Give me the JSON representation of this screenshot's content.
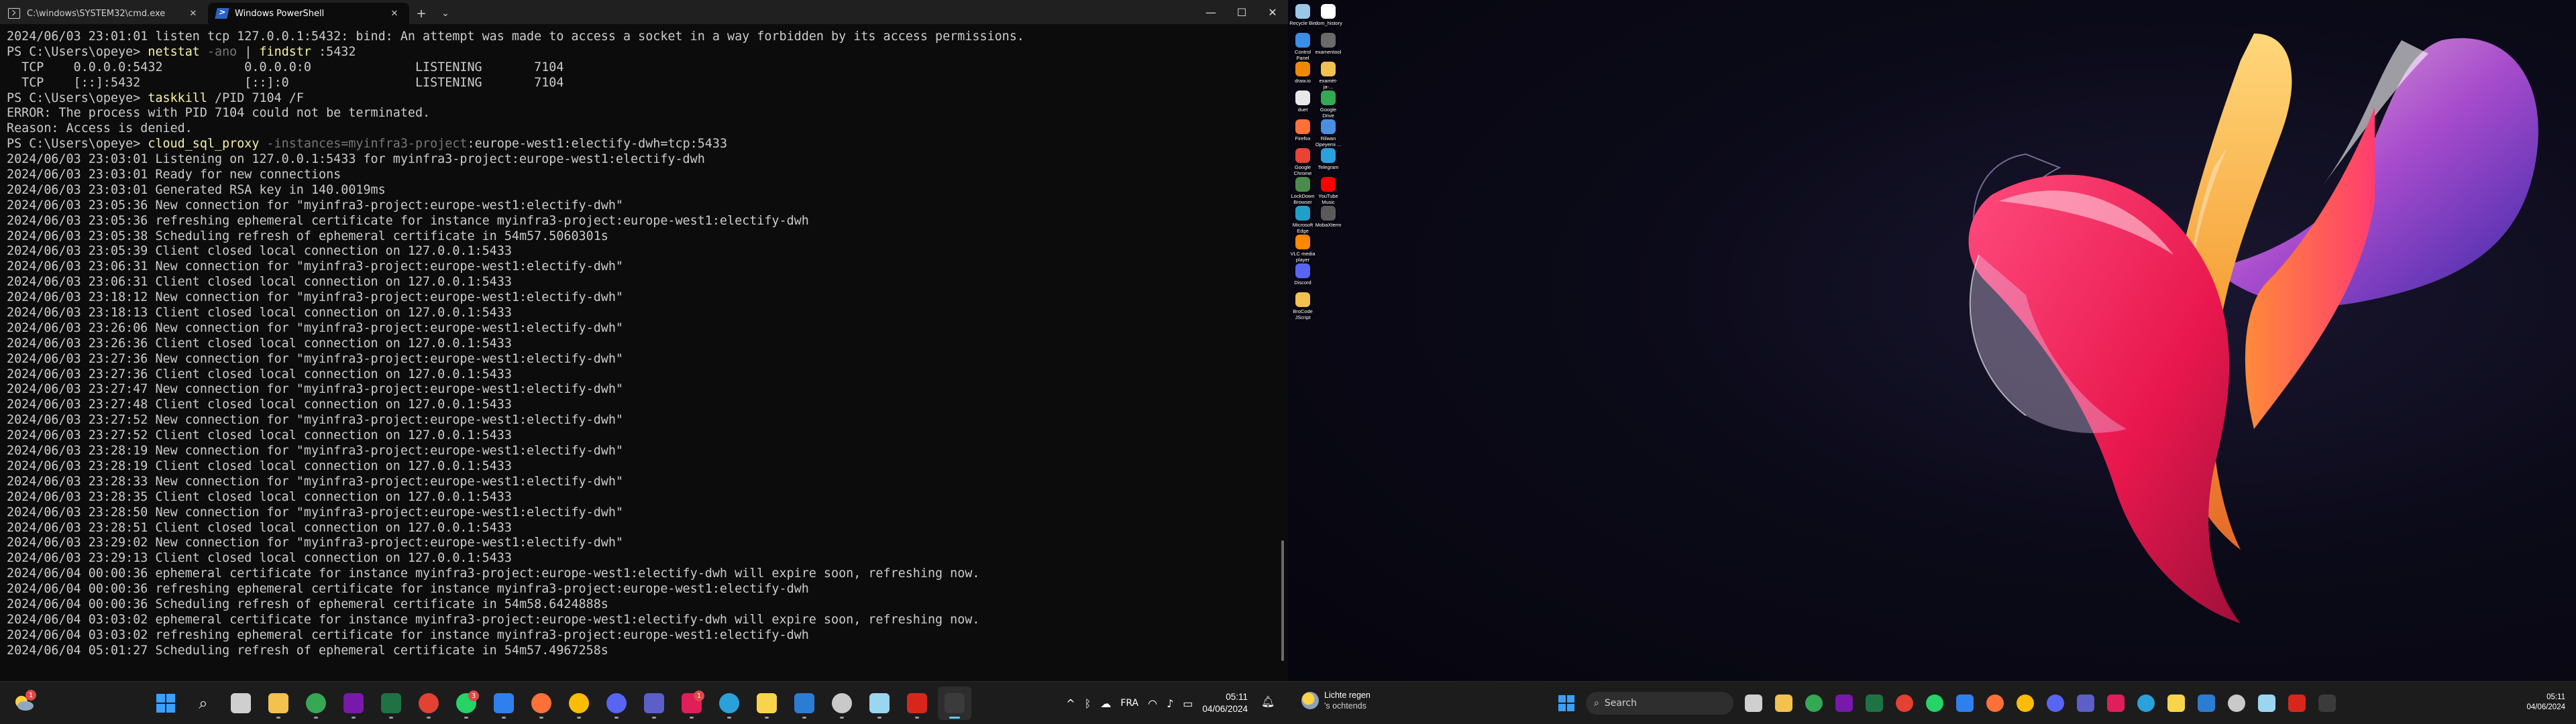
{
  "left_window": {
    "tabs": [
      {
        "title": "C:\\windows\\SYSTEM32\\cmd.exe",
        "active": false
      },
      {
        "title": "Windows PowerShell",
        "active": true
      }
    ],
    "new_tab": "+",
    "tab_dropdown": "⌄",
    "controls": {
      "minimize": "—",
      "maximize": "☐",
      "close": "✕"
    }
  },
  "terminal_lines": [
    [
      {
        "c": "plain",
        "t": "2024/06/03 23:01:01 listen tcp 127.0.0.1:5432: bind: An attempt was made to access a socket in a way forbidden by its access permissions."
      }
    ],
    [
      {
        "c": "prompt",
        "t": "PS C:\\Users\\opeye> "
      },
      {
        "c": "cmd",
        "t": "netstat"
      },
      {
        "c": "arg",
        "t": " -ano"
      },
      {
        "c": "plain",
        "t": " | "
      },
      {
        "c": "cmd",
        "t": "findstr"
      },
      {
        "c": "plain",
        "t": " :5432"
      }
    ],
    [
      {
        "c": "plain",
        "t": "  TCP    0.0.0.0:5432           0.0.0.0:0              LISTENING       7104"
      }
    ],
    [
      {
        "c": "plain",
        "t": "  TCP    [::]:5432              [::]:0                 LISTENING       7104"
      }
    ],
    [
      {
        "c": "prompt",
        "t": "PS C:\\Users\\opeye> "
      },
      {
        "c": "cmd",
        "t": "taskkill"
      },
      {
        "c": "plain",
        "t": " /PID 7104 /F"
      }
    ],
    [
      {
        "c": "plain",
        "t": "ERROR: The process with PID 7104 could not be terminated."
      }
    ],
    [
      {
        "c": "plain",
        "t": "Reason: Access is denied."
      }
    ],
    [
      {
        "c": "prompt",
        "t": "PS C:\\Users\\opeye> "
      },
      {
        "c": "cmd",
        "t": "cloud_sql_proxy"
      },
      {
        "c": "arg",
        "t": " -instances=myinfra3-project"
      },
      {
        "c": "plain",
        "t": ":europe-west1:electify-dwh=tcp:5433"
      }
    ],
    [
      {
        "c": "plain",
        "t": "2024/06/03 23:03:01 Listening on 127.0.0.1:5433 for myinfra3-project:europe-west1:electify-dwh"
      }
    ],
    [
      {
        "c": "plain",
        "t": "2024/06/03 23:03:01 Ready for new connections"
      }
    ],
    [
      {
        "c": "plain",
        "t": "2024/06/03 23:03:01 Generated RSA key in 140.0019ms"
      }
    ],
    [
      {
        "c": "plain",
        "t": "2024/06/03 23:05:36 New connection for \"myinfra3-project:europe-west1:electify-dwh\""
      }
    ],
    [
      {
        "c": "plain",
        "t": "2024/06/03 23:05:36 refreshing ephemeral certificate for instance myinfra3-project:europe-west1:electify-dwh"
      }
    ],
    [
      {
        "c": "plain",
        "t": "2024/06/03 23:05:38 Scheduling refresh of ephemeral certificate in 54m57.5060301s"
      }
    ],
    [
      {
        "c": "plain",
        "t": "2024/06/03 23:05:39 Client closed local connection on 127.0.0.1:5433"
      }
    ],
    [
      {
        "c": "plain",
        "t": "2024/06/03 23:06:31 New connection for \"myinfra3-project:europe-west1:electify-dwh\""
      }
    ],
    [
      {
        "c": "plain",
        "t": "2024/06/03 23:06:31 Client closed local connection on 127.0.0.1:5433"
      }
    ],
    [
      {
        "c": "plain",
        "t": "2024/06/03 23:18:12 New connection for \"myinfra3-project:europe-west1:electify-dwh\""
      }
    ],
    [
      {
        "c": "plain",
        "t": "2024/06/03 23:18:13 Client closed local connection on 127.0.0.1:5433"
      }
    ],
    [
      {
        "c": "plain",
        "t": "2024/06/03 23:26:06 New connection for \"myinfra3-project:europe-west1:electify-dwh\""
      }
    ],
    [
      {
        "c": "plain",
        "t": "2024/06/03 23:26:36 Client closed local connection on 127.0.0.1:5433"
      }
    ],
    [
      {
        "c": "plain",
        "t": "2024/06/03 23:27:36 New connection for \"myinfra3-project:europe-west1:electify-dwh\""
      }
    ],
    [
      {
        "c": "plain",
        "t": "2024/06/03 23:27:36 Client closed local connection on 127.0.0.1:5433"
      }
    ],
    [
      {
        "c": "plain",
        "t": "2024/06/03 23:27:47 New connection for \"myinfra3-project:europe-west1:electify-dwh\""
      }
    ],
    [
      {
        "c": "plain",
        "t": "2024/06/03 23:27:48 Client closed local connection on 127.0.0.1:5433"
      }
    ],
    [
      {
        "c": "plain",
        "t": "2024/06/03 23:27:52 New connection for \"myinfra3-project:europe-west1:electify-dwh\""
      }
    ],
    [
      {
        "c": "plain",
        "t": "2024/06/03 23:27:52 Client closed local connection on 127.0.0.1:5433"
      }
    ],
    [
      {
        "c": "plain",
        "t": "2024/06/03 23:28:19 New connection for \"myinfra3-project:europe-west1:electify-dwh\""
      }
    ],
    [
      {
        "c": "plain",
        "t": "2024/06/03 23:28:19 Client closed local connection on 127.0.0.1:5433"
      }
    ],
    [
      {
        "c": "plain",
        "t": "2024/06/03 23:28:33 New connection for \"myinfra3-project:europe-west1:electify-dwh\""
      }
    ],
    [
      {
        "c": "plain",
        "t": "2024/06/03 23:28:35 Client closed local connection on 127.0.0.1:5433"
      }
    ],
    [
      {
        "c": "plain",
        "t": "2024/06/03 23:28:50 New connection for \"myinfra3-project:europe-west1:electify-dwh\""
      }
    ],
    [
      {
        "c": "plain",
        "t": "2024/06/03 23:28:51 Client closed local connection on 127.0.0.1:5433"
      }
    ],
    [
      {
        "c": "plain",
        "t": "2024/06/03 23:29:02 New connection for \"myinfra3-project:europe-west1:electify-dwh\""
      }
    ],
    [
      {
        "c": "plain",
        "t": "2024/06/03 23:29:13 Client closed local connection on 127.0.0.1:5433"
      }
    ],
    [
      {
        "c": "plain",
        "t": "2024/06/04 00:00:36 ephemeral certificate for instance myinfra3-project:europe-west1:electify-dwh will expire soon, refreshing now."
      }
    ],
    [
      {
        "c": "plain",
        "t": "2024/06/04 00:00:36 refreshing ephemeral certificate for instance myinfra3-project:europe-west1:electify-dwh"
      }
    ],
    [
      {
        "c": "plain",
        "t": "2024/06/04 00:00:36 Scheduling refresh of ephemeral certificate in 54m58.6424888s"
      }
    ],
    [
      {
        "c": "plain",
        "t": "2024/06/04 03:03:02 ephemeral certificate for instance myinfra3-project:europe-west1:electify-dwh will expire soon, refreshing now."
      }
    ],
    [
      {
        "c": "plain",
        "t": "2024/06/04 03:03:02 refreshing ephemeral certificate for instance myinfra3-project:europe-west1:electify-dwh"
      }
    ],
    [
      {
        "c": "plain",
        "t": "2024/06/04 05:01:27 Scheduling refresh of ephemeral certificate in 54m57.4967258s"
      }
    ]
  ],
  "taskbar_left": {
    "weather_badge": "1",
    "icons": [
      {
        "name": "start",
        "color": "#3aa0ff"
      },
      {
        "name": "search",
        "color": "#dddddd"
      },
      {
        "name": "task-view",
        "color": "#cfcfcf"
      },
      {
        "name": "file-explorer",
        "color": "#f2c14e"
      },
      {
        "name": "chrome",
        "color": "#34a853"
      },
      {
        "name": "onenote",
        "color": "#7719aa"
      },
      {
        "name": "excel",
        "color": "#1f7244"
      },
      {
        "name": "chrome-profile",
        "color": "#e34133"
      },
      {
        "name": "whatsapp",
        "color": "#25d366",
        "badge": "3"
      },
      {
        "name": "vscode",
        "color": "#2f80ed"
      },
      {
        "name": "firefox",
        "color": "#ff7139"
      },
      {
        "name": "chrome-2",
        "color": "#fbbc05"
      },
      {
        "name": "discord",
        "color": "#5865f2"
      },
      {
        "name": "teams",
        "color": "#5b5fc7"
      },
      {
        "name": "slack",
        "color": "#e01e5a",
        "badge": "1"
      },
      {
        "name": "telegram",
        "color": "#2aa1da"
      },
      {
        "name": "sticky-notes",
        "color": "#f7d44c"
      },
      {
        "name": "word-doc",
        "color": "#2b7cd3"
      },
      {
        "name": "clock-app",
        "color": "#c9c9c9"
      },
      {
        "name": "snipping",
        "color": "#9ad6f0"
      },
      {
        "name": "acrobat",
        "color": "#d9261c"
      },
      {
        "name": "terminal",
        "color": "#3b3b3b",
        "active": true
      }
    ],
    "tray": {
      "chevron": "^",
      "lang": "FRA"
    },
    "time": "05:11",
    "date": "04/06/2024"
  },
  "desktop_icons": [
    {
      "label": "Recycle Bin",
      "color": "#9cc7e8"
    },
    {
      "label": "dom_history",
      "color": "#ffffff"
    },
    {
      "label": "Control Panel",
      "color": "#3a8ee6"
    },
    {
      "label": "examentool",
      "color": "#6a6a6a"
    },
    {
      "label": "draw.io",
      "color": "#f08705"
    },
    {
      "label": "examét-ja-...",
      "color": "#f2c14e"
    },
    {
      "label": "duet",
      "color": "#e8e8e8"
    },
    {
      "label": "Google Drive",
      "color": "#34a853"
    },
    {
      "label": "Firefox",
      "color": "#ff7139"
    },
    {
      "label": "Rilwan Opeyemi ...",
      "color": "#4a90e2"
    },
    {
      "label": "Google Chrome",
      "color": "#ea4335"
    },
    {
      "label": "Telegram",
      "color": "#2aa1da"
    },
    {
      "label": "LockDown Browser",
      "color": "#4c8c4a"
    },
    {
      "label": "YouTube Music",
      "color": "#ff0000"
    },
    {
      "label": "Microsoft Edge",
      "color": "#1fa0c9"
    },
    {
      "label": "MobaXterm",
      "color": "#5a5a5a"
    },
    {
      "label": "VLC media player",
      "color": "#ff8800"
    },
    {
      "label": "Discord",
      "color": "#5865f2"
    },
    {
      "label": "BroCode JScript",
      "color": "#f2c14e"
    }
  ],
  "taskbar_right": {
    "weather_title": "Lichte regen",
    "weather_sub": "'s ochtends",
    "search_placeholder": "Search",
    "icons": [
      {
        "name": "task-view",
        "color": "#cfcfcf"
      },
      {
        "name": "file-explorer",
        "color": "#f2c14e"
      },
      {
        "name": "chrome",
        "color": "#34a853"
      },
      {
        "name": "onenote",
        "color": "#7719aa"
      },
      {
        "name": "excel",
        "color": "#1f7244"
      },
      {
        "name": "chrome-profile",
        "color": "#e34133"
      },
      {
        "name": "whatsapp",
        "color": "#25d366"
      },
      {
        "name": "vscode",
        "color": "#2f80ed"
      },
      {
        "name": "firefox",
        "color": "#ff7139"
      },
      {
        "name": "chrome-2",
        "color": "#fbbc05"
      },
      {
        "name": "discord",
        "color": "#5865f2"
      },
      {
        "name": "teams",
        "color": "#5b5fc7"
      },
      {
        "name": "slack",
        "color": "#e01e5a"
      },
      {
        "name": "telegram",
        "color": "#2aa1da"
      },
      {
        "name": "sticky-notes",
        "color": "#f7d44c"
      },
      {
        "name": "word-doc",
        "color": "#2b7cd3"
      },
      {
        "name": "clock-app",
        "color": "#c9c9c9"
      },
      {
        "name": "snipping",
        "color": "#9ad6f0"
      },
      {
        "name": "acrobat",
        "color": "#d9261c"
      },
      {
        "name": "terminal",
        "color": "#3b3b3b"
      }
    ],
    "time": "05:11",
    "date": "04/06/2024"
  }
}
